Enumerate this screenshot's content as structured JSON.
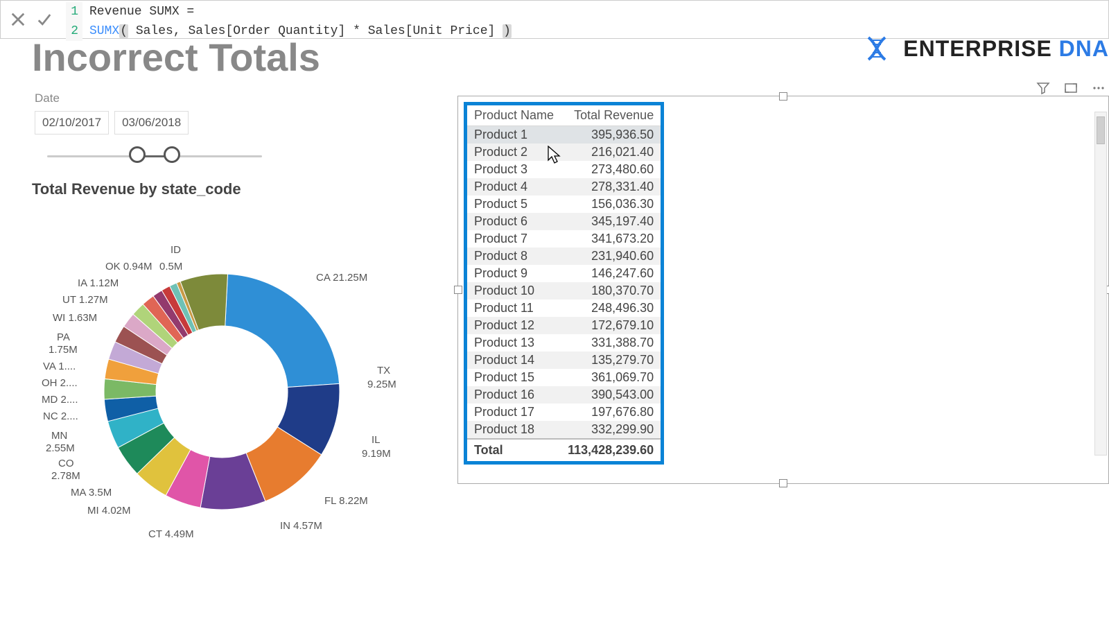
{
  "formula": {
    "line1_no": "1",
    "line1_text": "Revenue SUMX =",
    "line2_no": "2",
    "line2_fn": "SUMX",
    "line2_rest": " Sales, Sales[Order Quantity] * Sales[Unit Price] "
  },
  "header": {
    "title": "Incorrect Totals",
    "brand1": "ENTERPRISE",
    "brand2": "DNA"
  },
  "date_slicer": {
    "caption": "Date",
    "from": "02/10/2017",
    "to": "03/06/2018"
  },
  "donut": {
    "title": "Total Revenue by state_code"
  },
  "chart_data": {
    "type": "pie",
    "title": "Total Revenue by state_code",
    "unit": "M",
    "series": [
      {
        "name": "CA",
        "value": 21.25,
        "label": "CA 21.25M",
        "color": "#2f8fd6"
      },
      {
        "name": "TX",
        "value": 9.25,
        "label": "TX 9.25M",
        "color": "#1f3c88"
      },
      {
        "name": "IL",
        "value": 9.19,
        "label": "IL 9.19M",
        "color": "#e77c2f"
      },
      {
        "name": "FL",
        "value": 8.22,
        "label": "FL 8.22M",
        "color": "#6a3f96"
      },
      {
        "name": "IN",
        "value": 4.57,
        "label": "IN 4.57M",
        "color": "#e055a8"
      },
      {
        "name": "CT",
        "value": 4.49,
        "label": "CT 4.49M",
        "color": "#e0c23d"
      },
      {
        "name": "MI",
        "value": 4.02,
        "label": "MI 4.02M",
        "color": "#1e8a5a"
      },
      {
        "name": "MA",
        "value": 3.5,
        "label": "MA 3.5M",
        "color": "#30b2c7"
      },
      {
        "name": "CO",
        "value": 2.78,
        "label": "CO 2.78M",
        "color": "#0f5fa6"
      },
      {
        "name": "MN",
        "value": 2.55,
        "label": "MN 2.55M",
        "color": "#7bb965"
      },
      {
        "name": "NC",
        "value": 2.5,
        "label": "NC 2....",
        "color": "#f0a03c"
      },
      {
        "name": "MD",
        "value": 2.3,
        "label": "MD 2....",
        "color": "#c3a9d6"
      },
      {
        "name": "OH",
        "value": 2.2,
        "label": "OH 2....",
        "color": "#9c5252"
      },
      {
        "name": "VA",
        "value": 1.9,
        "label": "VA 1....",
        "color": "#dba8c7"
      },
      {
        "name": "PA",
        "value": 1.75,
        "label": "PA 1.75M",
        "color": "#b0d47a"
      },
      {
        "name": "WI",
        "value": 1.63,
        "label": "WI 1.63M",
        "color": "#e06555"
      },
      {
        "name": "UT",
        "value": 1.27,
        "label": "UT 1.27M",
        "color": "#933a6d"
      },
      {
        "name": "IA",
        "value": 1.12,
        "label": "IA 1.12M",
        "color": "#c73a3a"
      },
      {
        "name": "OK",
        "value": 0.94,
        "label": "OK 0.94M",
        "color": "#6fc1b5"
      },
      {
        "name": "ID",
        "value": 0.5,
        "label": "ID",
        "color": "#c99a46"
      },
      {
        "name": "other",
        "value": 6.0,
        "label": "",
        "color": "#7d8a3a"
      }
    ]
  },
  "table": {
    "col1": "Product Name",
    "col2": "Total Revenue",
    "rows": [
      {
        "p": "Product 1",
        "v": "395,936.50"
      },
      {
        "p": "Product 2",
        "v": "216,021.40"
      },
      {
        "p": "Product 3",
        "v": "273,480.60"
      },
      {
        "p": "Product 4",
        "v": "278,331.40"
      },
      {
        "p": "Product 5",
        "v": "156,036.30"
      },
      {
        "p": "Product 6",
        "v": "345,197.40"
      },
      {
        "p": "Product 7",
        "v": "341,673.20"
      },
      {
        "p": "Product 8",
        "v": "231,940.60"
      },
      {
        "p": "Product 9",
        "v": "146,247.60"
      },
      {
        "p": "Product 10",
        "v": "180,370.70"
      },
      {
        "p": "Product 11",
        "v": "248,496.30"
      },
      {
        "p": "Product 12",
        "v": "172,679.10"
      },
      {
        "p": "Product 13",
        "v": "331,388.70"
      },
      {
        "p": "Product 14",
        "v": "135,279.70"
      },
      {
        "p": "Product 15",
        "v": "361,069.70"
      },
      {
        "p": "Product 16",
        "v": "390,543.00"
      },
      {
        "p": "Product 17",
        "v": "197,676.80"
      },
      {
        "p": "Product 18",
        "v": "332,299.90"
      }
    ],
    "total_label": "Total",
    "total_value": "113,428,239.60"
  },
  "labels": {
    "dl_ca": "CA 21.25M",
    "dl_tx1": "TX",
    "dl_tx2": "9.25M",
    "dl_il1": "IL",
    "dl_il2": "9.19M",
    "dl_fl": "FL 8.22M",
    "dl_in": "IN 4.57M",
    "dl_ct": "CT 4.49M",
    "dl_mi": "MI 4.02M",
    "dl_ma": "MA 3.5M",
    "dl_co1": "CO",
    "dl_co2": "2.78M",
    "dl_mn1": "MN",
    "dl_mn2": "2.55M",
    "dl_nc": "NC 2....",
    "dl_md": "MD 2....",
    "dl_oh": "OH 2....",
    "dl_va": "VA 1....",
    "dl_pa1": "PA",
    "dl_pa2": "1.75M",
    "dl_wi": "WI 1.63M",
    "dl_ut": "UT 1.27M",
    "dl_ia": "IA 1.12M",
    "dl_ok": "OK 0.94M",
    "dl_id": "ID",
    "dl_05m": "0.5M"
  }
}
